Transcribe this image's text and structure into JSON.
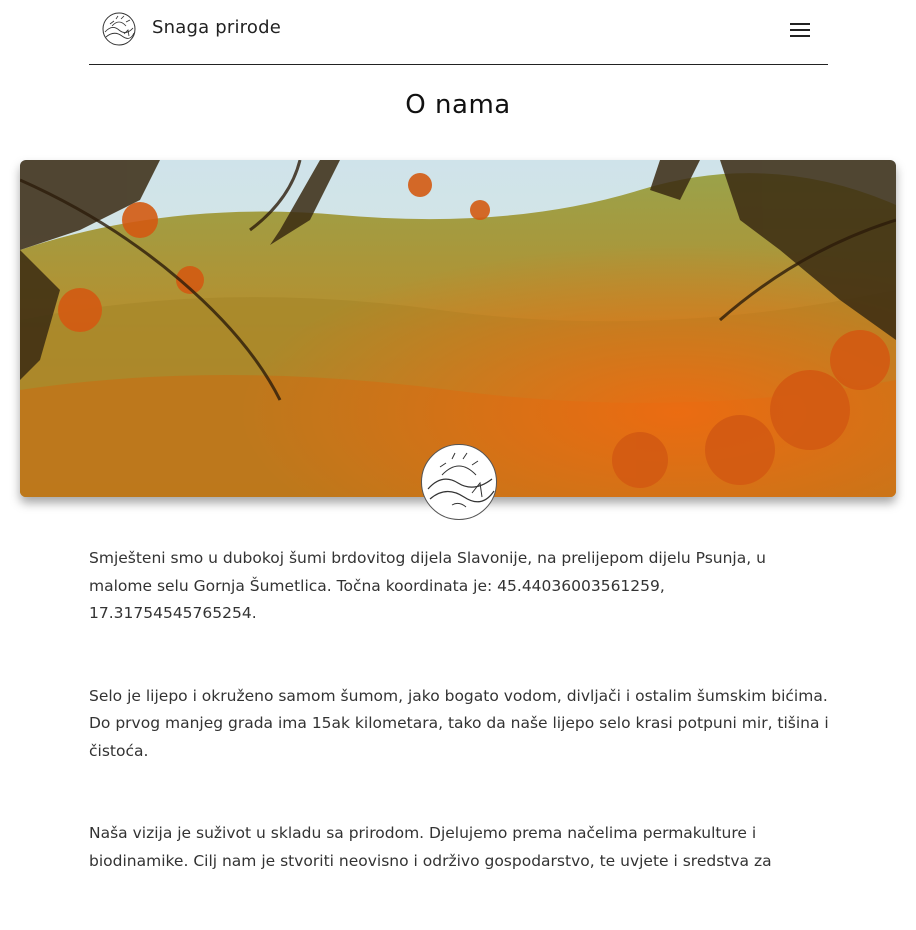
{
  "header": {
    "brand": "Snaga prirode",
    "logo_icon": "sun-hills-logo-icon",
    "menu_icon": "hamburger-menu-icon"
  },
  "page": {
    "title": "O nama"
  },
  "hero": {
    "image": "autumn-forest-photo",
    "badge_icon": "sun-hills-logo-icon"
  },
  "content": {
    "paragraphs": [
      "Smješteni smo u dubokoj šumi brdovitog dijela Slavonije, na prelijepom dijelu Psunja, u malome selu Gornja Šumetlica. Točna koordinata je: 45.44036003561259, 17.31754545765254.",
      "Selo je lijepo i okruženo samom šumom, jako bogato vodom, divljači i ostalim šumskim bićima. Do prvog manjeg grada ima 15ak kilometara, tako da naše lijepo selo krasi potpuni mir, tišina i čistoća.",
      "Naša vizija je suživot u skladu sa prirodom. Djelujemo prema načelima permakulture i biodinamike. Cilj nam je stvoriti neovisno i održivo gospodarstvo, te uvjete i sredstva za"
    ]
  }
}
